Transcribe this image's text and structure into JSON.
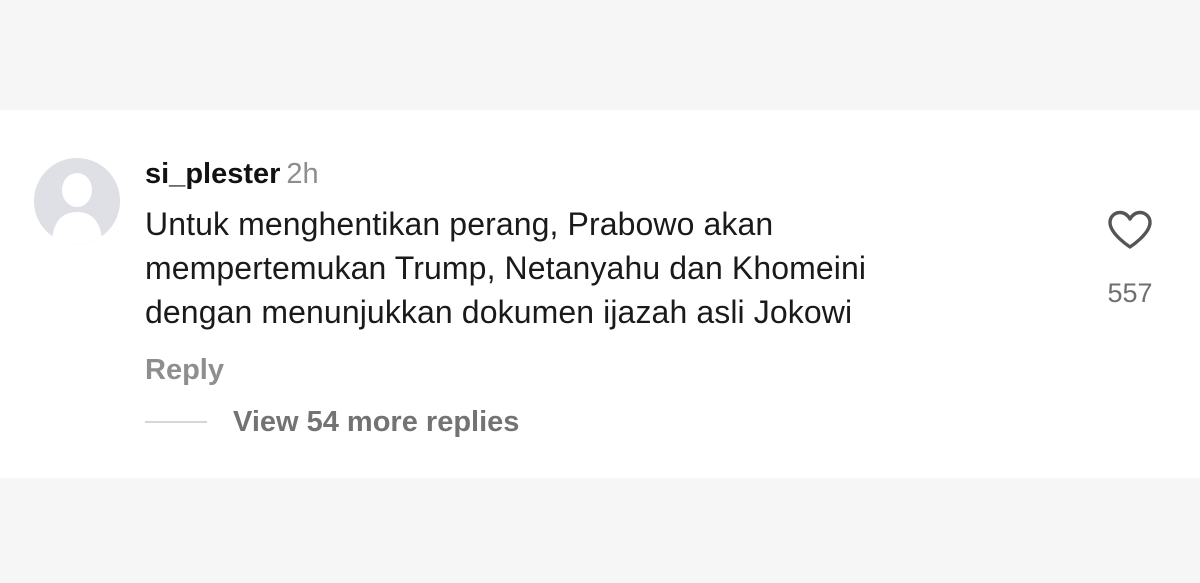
{
  "comment": {
    "avatar_icon": "default-profile-avatar-icon",
    "username": "si_plester",
    "timestamp": "2h",
    "text": "Untuk menghentikan perang, Prabowo akan\nmempertemukan Trump, Netanyahu dan Khomeini\ndengan menunjukkan dokumen ijazah asli Jokowi",
    "like_icon": "heart-outline-icon",
    "like_count": "557",
    "reply_label": "Reply",
    "view_replies_label": "View 54 more replies"
  },
  "colors": {
    "background": "#ffffff",
    "outer_background": "#f6f6f7",
    "primary_text": "#1a1a1a",
    "secondary_text": "#8e8e8e",
    "avatar_bg": "#dfe0e6",
    "avatar_fg": "#ffffff"
  }
}
